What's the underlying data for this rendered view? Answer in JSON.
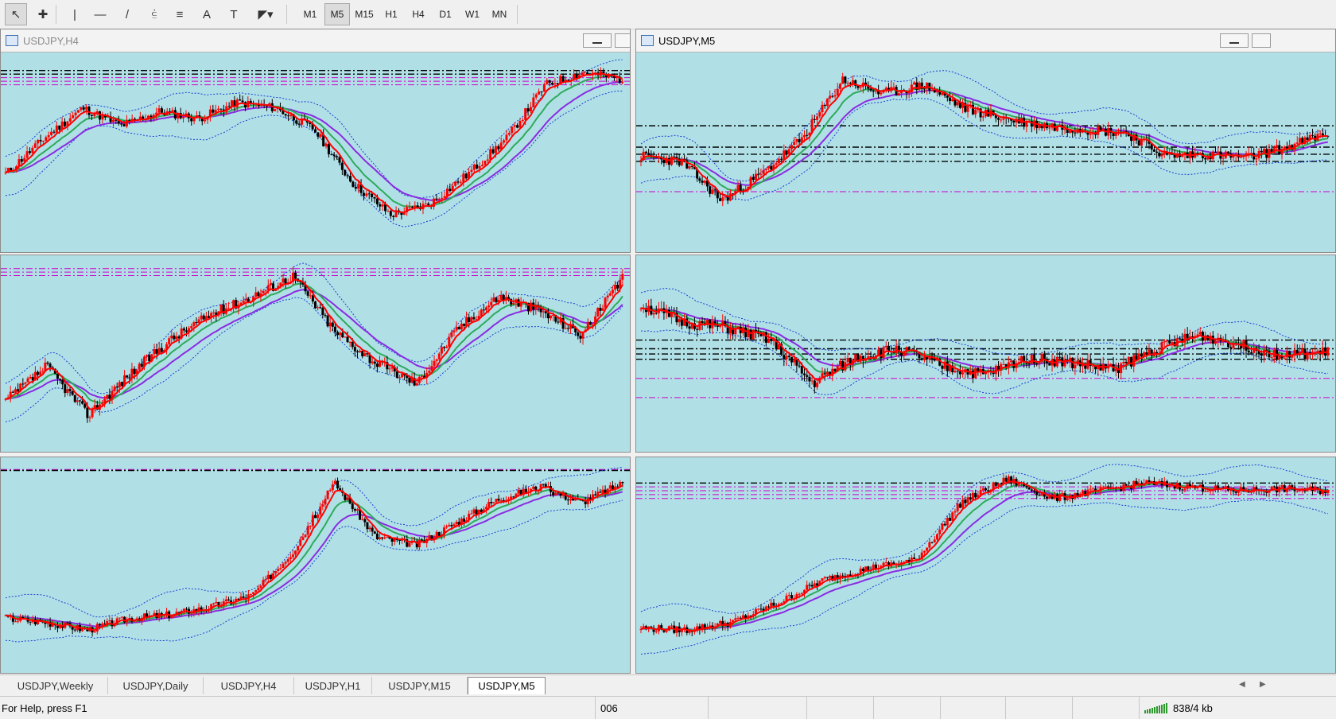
{
  "toolbar": {
    "tools": [
      {
        "name": "cursor-icon",
        "glyph": "↖"
      },
      {
        "name": "crosshair-icon",
        "glyph": "✚"
      },
      {
        "name": "vertical-line-icon",
        "glyph": "|"
      },
      {
        "name": "horizontal-line-icon",
        "glyph": "—"
      },
      {
        "name": "trendline-icon",
        "glyph": "/"
      },
      {
        "name": "equidistant-channel-icon",
        "glyph": "⫃"
      },
      {
        "name": "fibonacci-icon",
        "glyph": "≡"
      },
      {
        "name": "text-icon",
        "glyph": "A"
      },
      {
        "name": "text-label-icon",
        "glyph": "T"
      },
      {
        "name": "shapes-dropdown-icon",
        "glyph": "◤▾"
      }
    ],
    "timeframes": [
      "M1",
      "M5",
      "M15",
      "H1",
      "H4",
      "D1",
      "W1",
      "MN"
    ],
    "active_timeframe": "M5"
  },
  "windows": [
    {
      "id": "w1",
      "title": "USDJPY,H4",
      "active": false
    },
    {
      "id": "w2",
      "title": "USDJPY,M5",
      "active": true
    }
  ],
  "tabs": [
    "USDJPY,Weekly",
    "USDJPY,Daily",
    "USDJPY,H4",
    "USDJPY,H1",
    "USDJPY,M15",
    "USDJPY,M5"
  ],
  "active_tab": "USDJPY,M5",
  "status": {
    "help": "For Help, press F1",
    "profile": "006",
    "traffic": "838/4 kb"
  },
  "colors": {
    "chart_bg": "#b0e0e6",
    "bull": "#ff0000",
    "bear": "#000000",
    "ma_fast": "#ff0000",
    "ma_mid": "#2eaa5a",
    "ma_slow": "#8a2be2",
    "bands": "#1a3fd0",
    "level_black": "#000000",
    "level_magenta": "#cc00cc"
  }
}
